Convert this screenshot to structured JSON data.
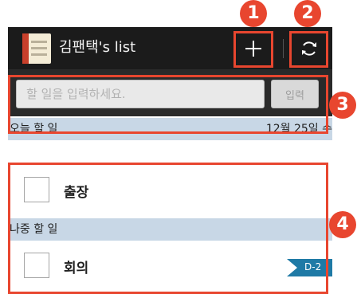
{
  "app": {
    "title": "김팬택's list",
    "icon": "notebook-icon",
    "add_icon": "plus-icon",
    "refresh_icon": "refresh-icon"
  },
  "input_bar": {
    "placeholder": "할 일을 입력하세요.",
    "value": "",
    "submit_label": "입력"
  },
  "today": {
    "label": "오늘 할 일",
    "date": "12월 25일 수",
    "tasks": [
      {
        "label": "출장",
        "checked": false
      }
    ]
  },
  "later": {
    "label": "나중 할 일",
    "tasks": [
      {
        "label": "회의",
        "checked": false,
        "dday": "D-2"
      }
    ]
  },
  "callouts": [
    "1",
    "2",
    "3",
    "4"
  ],
  "colors": {
    "callout": "#e8462f",
    "section_header": "#c8d7e6",
    "action_bar": "#1b1b1b",
    "dday_tag": "#1f7aa6"
  }
}
